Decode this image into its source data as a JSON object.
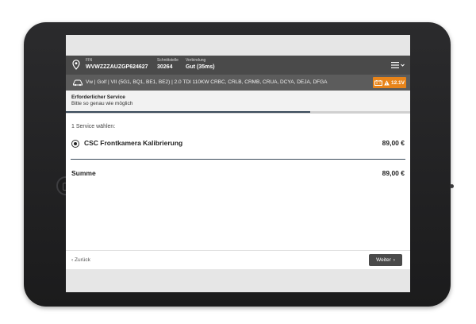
{
  "header": {
    "fin_label": "FIN",
    "fin_value": "WVWZZZAUZGP624627",
    "interface_label": "Schnittstelle",
    "interface_value": "30264",
    "connection_label": "Verbindung",
    "connection_value": "Gut (35ms)"
  },
  "vehicle": {
    "description": "Vw | Golf | VII (5G1, BQ1, BE1, BE2) | 2.0 TDI 110KW CRBC, CRLB, CRMB, CRUA, DCYA, DEJA, DFGA",
    "battery_voltage": "12.1V",
    "battery_badge_color": "#e8841a"
  },
  "service_header": {
    "title": "Erforderlicher Service",
    "subtitle": "Bitte so genau wie möglich",
    "progress": 0.71
  },
  "service_list": {
    "choose_label": "1 Service wählen:",
    "items": [
      {
        "name": "CSC Frontkamera Kalibrierung",
        "price": "89,00 €",
        "selected": true
      }
    ]
  },
  "summary": {
    "label": "Summe",
    "value": "89,00 €"
  },
  "footer": {
    "back_label": "Zurück",
    "next_label": "Weiter"
  },
  "colors": {
    "topbar": "#4a4a4a",
    "vehicle_bar": "#5c5c5c",
    "accent_dark": "#3a4a5a"
  }
}
